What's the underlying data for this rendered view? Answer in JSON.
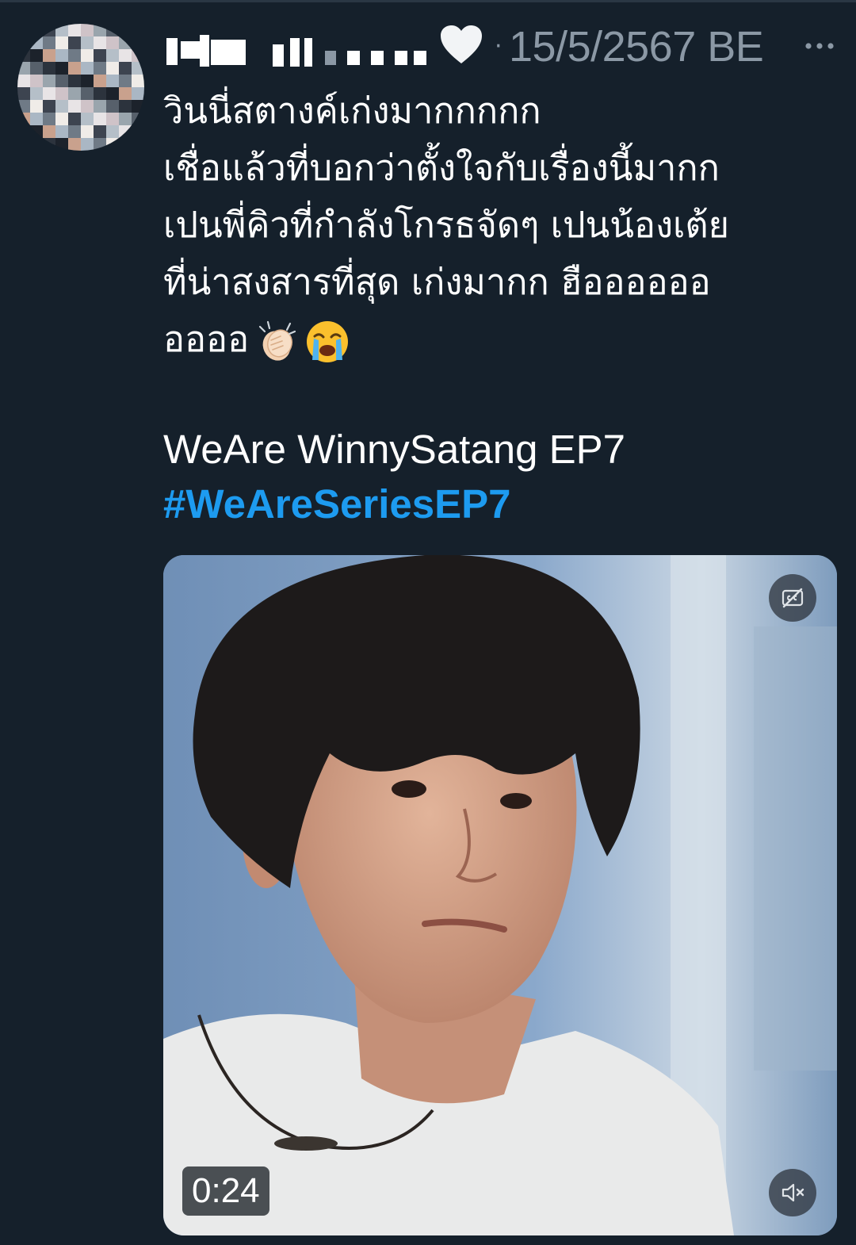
{
  "tweet": {
    "timestamp": "15/5/2567 BE",
    "separator": "·",
    "text": "วินนี่สตางค์เก่งมากกกกก\nเชื่อแล้วที่บอกว่าตั้งใจกับเรื่องนี้มากก\nเปนพี่คิวที่กำลังโกรธจัดๆ เปนน้องเต้ย\nที่น่าสงสารที่สุด เก่งมากก ฮืออออออ\nออออ",
    "emojis": [
      "clapping-hands-emoji",
      "loudly-crying-face-emoji"
    ],
    "caption": "WeAre WinnySatang EP7",
    "hashtag": "#WeAreSeriesEP7"
  },
  "media": {
    "type": "video",
    "duration": "0:24",
    "controls": [
      "captions-off-icon",
      "mute-icon"
    ]
  },
  "colors": {
    "background": "#15202b",
    "text": "#ffffff",
    "secondary_text": "#8b98a5",
    "hashtag": "#1d9bf0"
  }
}
